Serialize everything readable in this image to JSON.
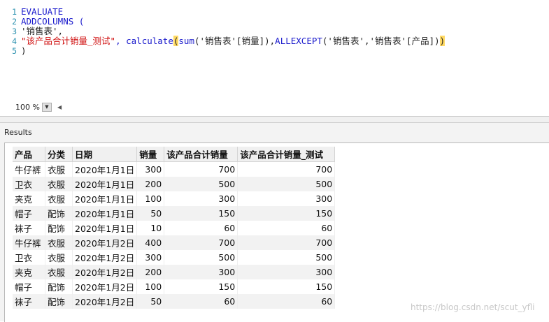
{
  "editor": {
    "lines": [
      {
        "num": "1",
        "t1": "EVALUATE"
      },
      {
        "num": "2",
        "t1": "ADDCOLUMNS ("
      },
      {
        "num": "3",
        "t1": "'销售表',"
      },
      {
        "num": "4",
        "t1": "\"该产品合计销量_测试\"",
        "t2": ", calculate",
        "t3": "(",
        "t4": "sum",
        "t5": "('销售表'[销量]),",
        "t6": "ALLEXCEPT",
        "t7": "('销售表','销售表'[产品])",
        "t8": ")"
      },
      {
        "num": "5",
        "t1": ")"
      }
    ],
    "zoom": "100 %"
  },
  "results": {
    "title": "Results",
    "columns": [
      "产品",
      "分类",
      "日期",
      "销量",
      "该产品合计销量",
      "该产品合计销量_测试"
    ],
    "rows": [
      [
        "牛仔裤",
        "衣服",
        "2020年1月1日",
        "300",
        "700",
        "700"
      ],
      [
        "卫衣",
        "衣服",
        "2020年1月1日",
        "200",
        "500",
        "500"
      ],
      [
        "夹克",
        "衣服",
        "2020年1月1日",
        "100",
        "300",
        "300"
      ],
      [
        "帽子",
        "配饰",
        "2020年1月1日",
        "50",
        "150",
        "150"
      ],
      [
        "袜子",
        "配饰",
        "2020年1月1日",
        "10",
        "60",
        "60"
      ],
      [
        "牛仔裤",
        "衣服",
        "2020年1月2日",
        "400",
        "700",
        "700"
      ],
      [
        "卫衣",
        "衣服",
        "2020年1月2日",
        "300",
        "500",
        "500"
      ],
      [
        "夹克",
        "衣服",
        "2020年1月2日",
        "200",
        "300",
        "300"
      ],
      [
        "帽子",
        "配饰",
        "2020年1月2日",
        "100",
        "150",
        "150"
      ],
      [
        "袜子",
        "配饰",
        "2020年1月2日",
        "50",
        "60",
        "60"
      ]
    ]
  },
  "watermark": "https://blog.csdn.net/scut_yfli",
  "colors": {
    "keyword": "#1a1acc",
    "string": "#d01010",
    "bracket_highlight": "#ffd964",
    "line_number": "#2b91af"
  }
}
